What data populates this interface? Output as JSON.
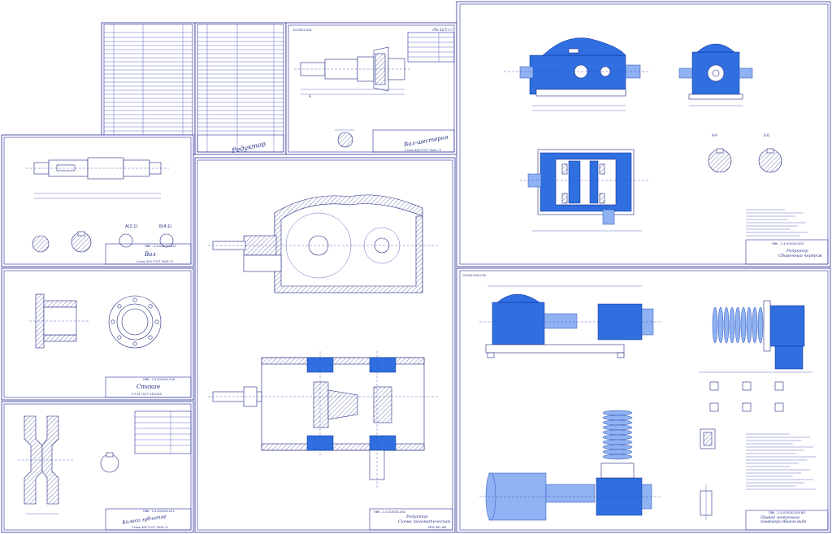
{
  "sheets": {
    "reducer_spec": {
      "stamp": "Редуктор"
    },
    "gear_shaft": {
      "stamp": "Вал-шестерня",
      "material": "Сталь 40Х ГОСТ 4543-71",
      "code_corner": "1013001.016"
    },
    "assembly_top_right": {
      "stamp": "Редуктор\nСборочный чертеж",
      "code": "ПВК - 2.4.013001.000"
    },
    "shaft": {
      "stamp": "Вал",
      "material": "Сталь 40Х ГОСТ 4543-71",
      "code": "ПВК - 2.4.013001.007"
    },
    "cup": {
      "stamp": "Стакан",
      "material": "СЧ 15 ГОСТ 1412-85",
      "code": "ПВК - 2.4.013001.016"
    },
    "gear_wheel": {
      "stamp": "Колесо зубчатое",
      "material": "Сталь 40Х ГОСТ 4543-71",
      "code": "ПВК - 2.4.013001.011"
    },
    "kinematic": {
      "stamp": "Редуктор\nСхема кинематическая",
      "code": "ПВК - 2.4.013001.000",
      "group": "МПУ 461 ФЛ"
    },
    "drive": {
      "stamp": "Привод ленточного\nконвейера общего вида",
      "code": "ПВК - 2.4.013001.000 ВО",
      "corner": "0104013001 ВО"
    }
  },
  "labels": {
    "section_aa": "А-А",
    "section_bb": "Б-Б",
    "view_a": "А(2:1)",
    "view_b": "Б(4:1)",
    "roughness": "√Ra 12,5 (√)",
    "cut_a": "А",
    "cut_b": "Б"
  }
}
